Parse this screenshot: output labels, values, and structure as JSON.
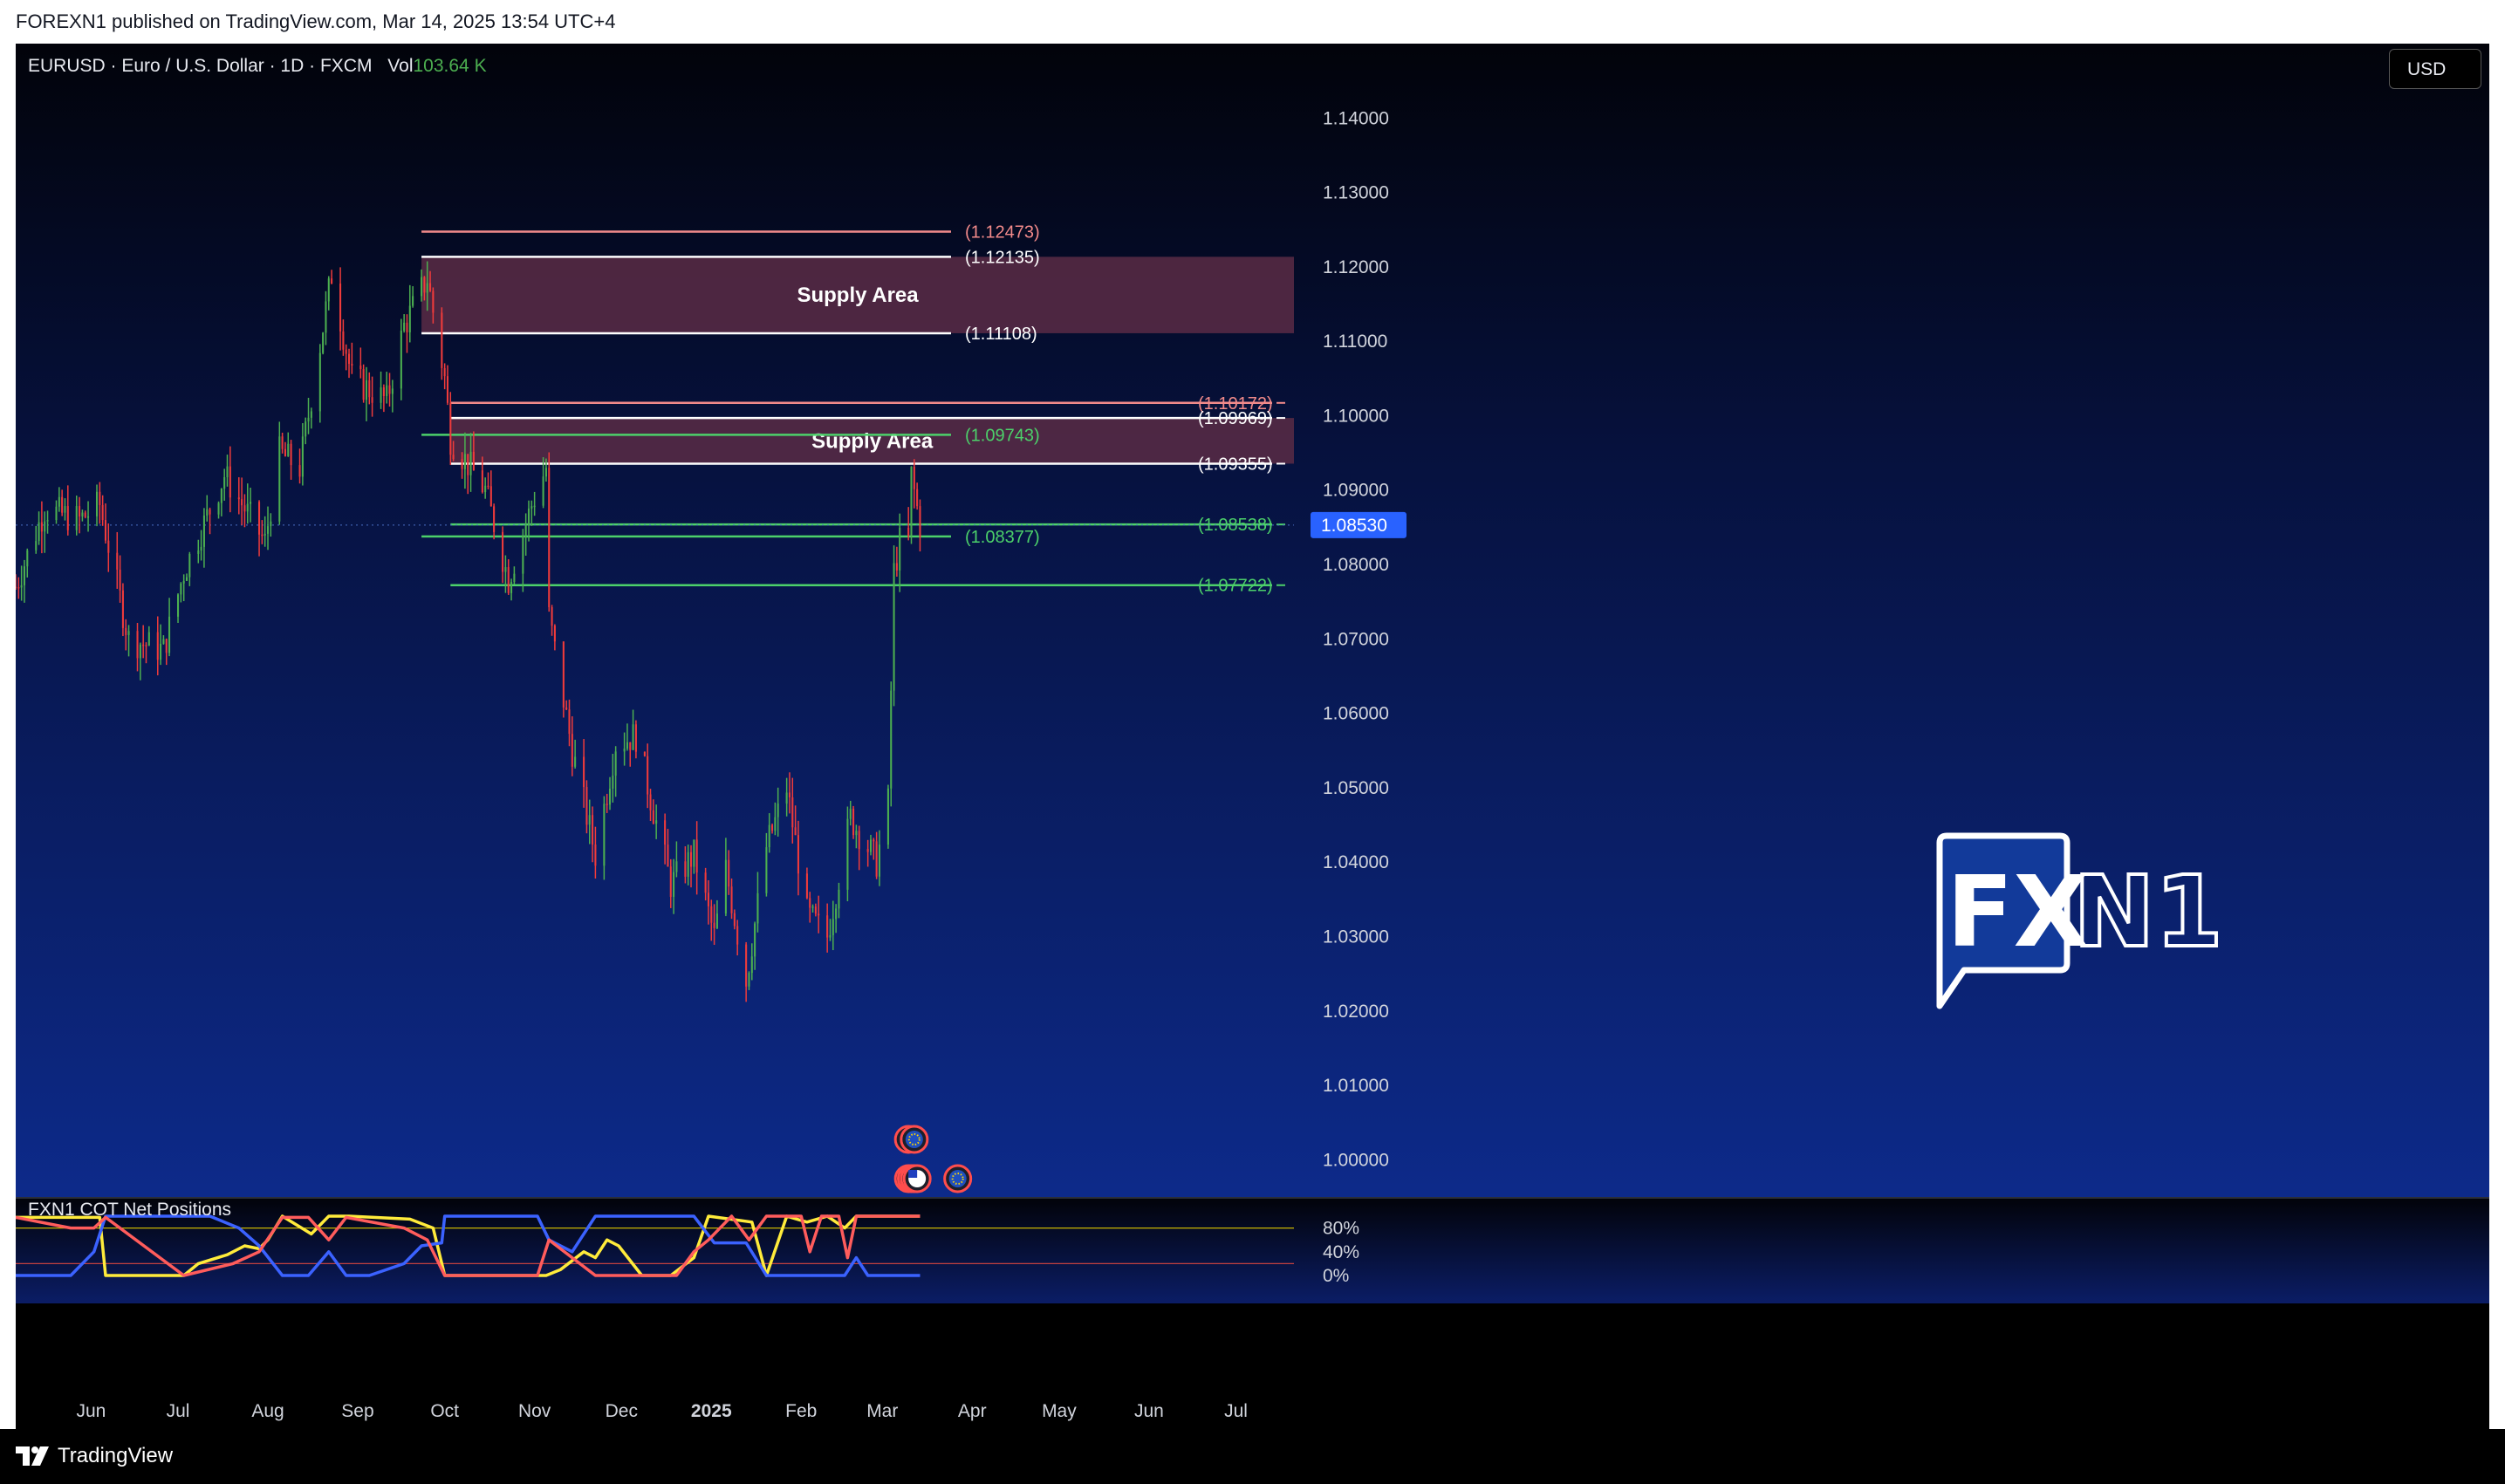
{
  "published_by": "FOREXN1 published on TradingView.com, Mar 14, 2025 13:54 UTC+4",
  "symbol_header": {
    "symbol": "EURUSD",
    "name": "Euro / U.S. Dollar",
    "interval": "1D",
    "source": "FXCM",
    "vol_label": "Vol",
    "vol_value": "103.64 K"
  },
  "currency_button": "USD",
  "indicator_title": "FXN1 COT Net Positions",
  "footer_brand": "TradingView",
  "watermark": {
    "part1": "FX",
    "part2": "N1"
  },
  "colors": {
    "bull": "#4caf50",
    "bear": "#ef3b3b",
    "supply_zone": "#5a2b45",
    "fib_red": "#f28a8a",
    "fib_white": "#ffffff",
    "fib_green": "#4cd16a",
    "last_price_bg": "#2962ff",
    "cot_yellow": "#ffeb3b",
    "cot_blue": "#3b62ff",
    "cot_red": "#ff5c5c"
  },
  "chart_data": [
    {
      "type": "candlestick",
      "ylim": [
        0.995,
        1.15
      ],
      "y_ticks": [
        "1.14000",
        "1.13000",
        "1.12000",
        "1.11000",
        "1.10000",
        "1.09000",
        "1.08000",
        "1.07000",
        "1.06000",
        "1.05000",
        "1.04000",
        "1.03000",
        "1.02000",
        "1.01000",
        "1.00000"
      ],
      "y_tick_values": [
        1.14,
        1.13,
        1.12,
        1.11,
        1.1,
        1.09,
        1.08,
        1.07,
        1.06,
        1.05,
        1.04,
        1.03,
        1.02,
        1.01,
        1.0
      ],
      "x_labels": [
        "Jun",
        "Jul",
        "Aug",
        "Sep",
        "Oct",
        "Nov",
        "Dec",
        "2025",
        "Feb",
        "Mar",
        "Apr",
        "May",
        "Jun",
        "Jul"
      ],
      "x_label_dates": [
        "2024-06-01",
        "2024-07-01",
        "2024-08-01",
        "2024-09-01",
        "2024-10-01",
        "2024-11-01",
        "2024-12-01",
        "2025-01-01",
        "2025-02-01",
        "2025-03-01",
        "2025-04-01",
        "2025-05-01",
        "2025-06-01",
        "2025-07-01"
      ],
      "x_range": [
        "2024-05-06",
        "2025-07-21"
      ],
      "last_price": "1.08530",
      "last_price_value": 1.0853,
      "candle_anchors": [
        {
          "date": "2024-05-06",
          "close": 1.077
        },
        {
          "date": "2024-05-16",
          "close": 1.0875
        },
        {
          "date": "2024-05-28",
          "close": 1.086
        },
        {
          "date": "2024-06-04",
          "close": 1.088
        },
        {
          "date": "2024-06-14",
          "close": 1.07
        },
        {
          "date": "2024-06-26",
          "close": 1.0685
        },
        {
          "date": "2024-07-03",
          "close": 1.079
        },
        {
          "date": "2024-07-17",
          "close": 1.092
        },
        {
          "date": "2024-07-31",
          "close": 1.083
        },
        {
          "date": "2024-08-05",
          "close": 1.095
        },
        {
          "date": "2024-08-12",
          "close": 1.093
        },
        {
          "date": "2024-08-23",
          "close": 1.119
        },
        {
          "date": "2024-08-30",
          "close": 1.105
        },
        {
          "date": "2024-09-11",
          "close": 1.102
        },
        {
          "date": "2024-09-17",
          "close": 1.112
        },
        {
          "date": "2024-09-25",
          "close": 1.1185
        },
        {
          "date": "2024-10-01",
          "close": 1.105
        },
        {
          "date": "2024-10-03",
          "close": 1.097
        },
        {
          "date": "2024-10-15",
          "close": 1.09
        },
        {
          "date": "2024-10-23",
          "close": 1.078
        },
        {
          "date": "2024-10-31",
          "close": 1.088
        },
        {
          "date": "2024-11-05",
          "close": 1.093
        },
        {
          "date": "2024-11-06",
          "close": 1.073
        },
        {
          "date": "2024-11-14",
          "close": 1.055
        },
        {
          "date": "2024-11-22",
          "close": 1.041
        },
        {
          "date": "2024-11-29",
          "close": 1.056
        },
        {
          "date": "2024-12-06",
          "close": 1.057
        },
        {
          "date": "2024-12-18",
          "close": 1.037
        },
        {
          "date": "2024-12-26",
          "close": 1.041
        },
        {
          "date": "2025-01-02",
          "close": 1.03
        },
        {
          "date": "2025-01-06",
          "close": 1.039
        },
        {
          "date": "2025-01-13",
          "close": 1.024
        },
        {
          "date": "2025-01-20",
          "close": 1.042
        },
        {
          "date": "2025-01-27",
          "close": 1.05
        },
        {
          "date": "2025-02-03",
          "close": 1.033
        },
        {
          "date": "2025-02-10",
          "close": 1.03
        },
        {
          "date": "2025-02-18",
          "close": 1.046
        },
        {
          "date": "2025-02-27",
          "close": 1.04
        },
        {
          "date": "2025-03-03",
          "close": 1.048
        },
        {
          "date": "2025-03-04",
          "close": 1.063
        },
        {
          "date": "2025-03-05",
          "close": 1.079
        },
        {
          "date": "2025-03-07",
          "close": 1.083
        },
        {
          "date": "2025-03-10",
          "close": 1.083
        },
        {
          "date": "2025-03-11",
          "close": 1.092
        },
        {
          "date": "2025-03-14",
          "close": 1.0853
        }
      ],
      "zones": [
        {
          "label": "Supply Area",
          "top": 1.12135,
          "bottom": 1.11108,
          "start": "2024-09-23"
        },
        {
          "label": "Supply Area",
          "top": 1.09969,
          "bottom": 1.09355,
          "start": "2024-10-03"
        }
      ],
      "levels": [
        {
          "label": "(1.12473)",
          "value": 1.12473,
          "color": "#f28a8a",
          "start": "2024-09-23",
          "end": "2024-10-31",
          "label_at": "mid"
        },
        {
          "label": "(1.12135)",
          "value": 1.12135,
          "color": "#ffffff",
          "start": "2024-09-23",
          "end": "2024-10-31",
          "label_at": "mid"
        },
        {
          "label": "(1.11108)",
          "value": 1.11108,
          "color": "#ffffff",
          "start": "2024-09-23",
          "end": "2024-10-31",
          "label_at": "mid"
        },
        {
          "label": "(1.10172)",
          "value": 1.10172,
          "color": "#f28a8a",
          "start": "2024-10-03",
          "end": "2025-07-20",
          "label_at": "right"
        },
        {
          "label": "(1.09969)",
          "value": 1.09969,
          "color": "#ffffff",
          "start": "2024-10-03",
          "end": "2025-07-20",
          "label_at": "right"
        },
        {
          "label": "(1.09743)",
          "value": 1.09743,
          "color": "#4cd16a",
          "start": "2024-09-23",
          "end": "2024-10-31",
          "label_at": "mid"
        },
        {
          "label": "(1.09355)",
          "value": 1.09355,
          "color": "#ffffff",
          "start": "2024-10-03",
          "end": "2025-07-20",
          "label_at": "right"
        },
        {
          "label": "(1.08538)",
          "value": 1.08538,
          "color": "#4cd16a",
          "start": "2024-10-03",
          "end": "2025-07-20",
          "label_at": "right"
        },
        {
          "label": "(1.08377)",
          "value": 1.08377,
          "color": "#4cd16a",
          "start": "2024-09-23",
          "end": "2024-10-31",
          "label_at": "mid"
        },
        {
          "label": "(1.07722)",
          "value": 1.07722,
          "color": "#4cd16a",
          "start": "2024-10-03",
          "end": "2025-07-20",
          "label_at": "right"
        }
      ],
      "events": [
        {
          "date": "2025-03-10",
          "row": 1,
          "kind": "dividend"
        },
        {
          "date": "2025-03-12",
          "row": 1,
          "kind": "eu-flag"
        },
        {
          "date": "2025-03-10",
          "row": 2,
          "kind": "us-flag"
        },
        {
          "date": "2025-03-11",
          "row": 2,
          "kind": "us-flag"
        },
        {
          "date": "2025-03-12",
          "row": 2,
          "kind": "us-flag"
        },
        {
          "date": "2025-03-13",
          "row": 2,
          "kind": "us-flag"
        },
        {
          "date": "2025-03-27",
          "row": 2,
          "kind": "eu-flag"
        }
      ]
    },
    {
      "type": "line",
      "title": "FXN1 COT Net Positions",
      "ylim": [
        0,
        100
      ],
      "y_ticks": [
        "80%",
        "40%",
        "0%"
      ],
      "y_tick_values": [
        80,
        40,
        0
      ],
      "reference_lines": [
        80,
        20
      ],
      "series": [
        {
          "color": "#ffeb3b",
          "points": [
            [
              "2024-05-06",
              98
            ],
            [
              "2024-06-04",
              98
            ],
            [
              "2024-06-06",
              0
            ],
            [
              "2024-07-03",
              0
            ],
            [
              "2024-07-08",
              20
            ],
            [
              "2024-07-18",
              35
            ],
            [
              "2024-07-24",
              50
            ],
            [
              "2024-07-29",
              45
            ],
            [
              "2024-08-01",
              60
            ],
            [
              "2024-08-06",
              100
            ],
            [
              "2024-08-16",
              70
            ],
            [
              "2024-08-22",
              100
            ],
            [
              "2024-08-29",
              100
            ],
            [
              "2024-09-19",
              95
            ],
            [
              "2024-09-27",
              80
            ],
            [
              "2024-10-01",
              0
            ],
            [
              "2024-11-05",
              0
            ],
            [
              "2024-11-10",
              10
            ],
            [
              "2024-11-18",
              40
            ],
            [
              "2024-11-22",
              30
            ],
            [
              "2024-11-26",
              60
            ],
            [
              "2024-11-30",
              50
            ],
            [
              "2024-12-08",
              0
            ],
            [
              "2024-12-18",
              0
            ],
            [
              "2024-12-26",
              30
            ],
            [
              "2024-12-31",
              100
            ],
            [
              "2025-01-15",
              90
            ],
            [
              "2025-01-20",
              0
            ],
            [
              "2025-01-27",
              100
            ],
            [
              "2025-02-03",
              90
            ],
            [
              "2025-02-10",
              100
            ],
            [
              "2025-02-16",
              80
            ],
            [
              "2025-02-20",
              100
            ],
            [
              "2025-03-14",
              100
            ]
          ]
        },
        {
          "color": "#3b62ff",
          "points": [
            [
              "2024-05-06",
              0
            ],
            [
              "2024-05-25",
              0
            ],
            [
              "2024-06-02",
              40
            ],
            [
              "2024-06-06",
              100
            ],
            [
              "2024-07-12",
              100
            ],
            [
              "2024-07-22",
              80
            ],
            [
              "2024-07-29",
              50
            ],
            [
              "2024-08-06",
              0
            ],
            [
              "2024-08-15",
              0
            ],
            [
              "2024-08-22",
              40
            ],
            [
              "2024-08-28",
              0
            ],
            [
              "2024-09-05",
              0
            ],
            [
              "2024-09-17",
              20
            ],
            [
              "2024-09-23",
              50
            ],
            [
              "2024-09-30",
              55
            ],
            [
              "2024-10-01",
              100
            ],
            [
              "2024-11-02",
              100
            ],
            [
              "2024-11-06",
              60
            ],
            [
              "2024-11-14",
              40
            ],
            [
              "2024-11-22",
              100
            ],
            [
              "2024-12-26",
              100
            ],
            [
              "2025-01-02",
              55
            ],
            [
              "2025-01-13",
              55
            ],
            [
              "2025-01-20",
              0
            ],
            [
              "2025-02-16",
              0
            ],
            [
              "2025-02-20",
              30
            ],
            [
              "2025-02-24",
              0
            ],
            [
              "2025-03-14",
              0
            ]
          ]
        },
        {
          "color": "#ff5c5c",
          "points": [
            [
              "2024-05-06",
              98
            ],
            [
              "2024-05-25",
              80
            ],
            [
              "2024-06-02",
              80
            ],
            [
              "2024-06-06",
              98
            ],
            [
              "2024-07-03",
              0
            ],
            [
              "2024-07-20",
              20
            ],
            [
              "2024-07-29",
              40
            ],
            [
              "2024-08-06",
              98
            ],
            [
              "2024-08-15",
              98
            ],
            [
              "2024-08-22",
              60
            ],
            [
              "2024-08-28",
              98
            ],
            [
              "2024-09-17",
              80
            ],
            [
              "2024-09-25",
              60
            ],
            [
              "2024-10-01",
              0
            ],
            [
              "2024-11-02",
              0
            ],
            [
              "2024-11-06",
              60
            ],
            [
              "2024-11-14",
              30
            ],
            [
              "2024-11-22",
              0
            ],
            [
              "2024-12-20",
              0
            ],
            [
              "2024-12-26",
              40
            ],
            [
              "2024-12-31",
              60
            ],
            [
              "2025-01-08",
              100
            ],
            [
              "2025-01-14",
              60
            ],
            [
              "2025-01-20",
              100
            ],
            [
              "2025-02-01",
              100
            ],
            [
              "2025-02-04",
              40
            ],
            [
              "2025-02-08",
              100
            ],
            [
              "2025-02-14",
              100
            ],
            [
              "2025-02-17",
              30
            ],
            [
              "2025-02-20",
              100
            ],
            [
              "2025-03-14",
              100
            ]
          ]
        }
      ]
    }
  ]
}
